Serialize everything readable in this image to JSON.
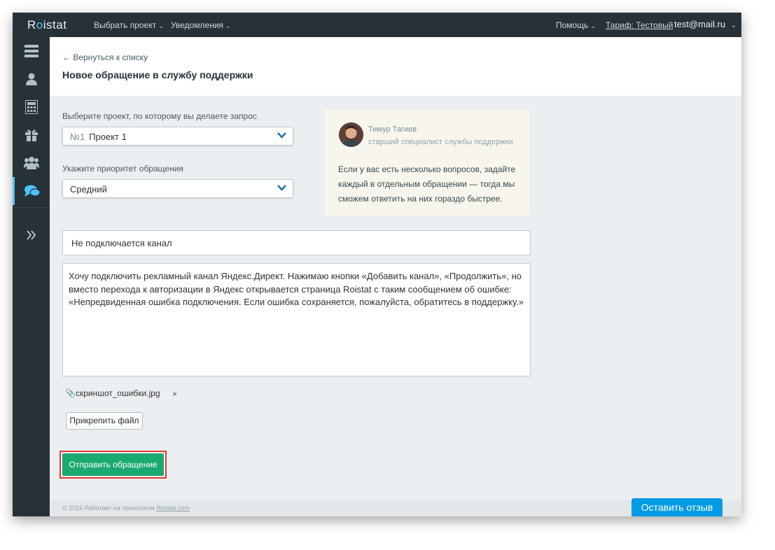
{
  "app": {
    "logo_prefix": "R",
    "logo_o": "o",
    "logo_suffix": "istat"
  },
  "topnav": {
    "choose_project": "Выбрать проект",
    "notifications": "Уведомления",
    "help": "Помощь",
    "tariff": "Тариф: Тестовый",
    "user_email": "test@mail.ru"
  },
  "sidebar": {
    "items": [
      {
        "icon": "server-stack-icon"
      },
      {
        "icon": "user-icon"
      },
      {
        "icon": "calculator-icon"
      },
      {
        "icon": "gift-icon"
      },
      {
        "icon": "users-icon"
      },
      {
        "icon": "chat-icon",
        "active": true
      },
      {
        "icon": "double-chevron-right-icon"
      }
    ]
  },
  "header": {
    "back_link": "← Вернуться к списку",
    "title": "Новое обращение в службу поддержки"
  },
  "form": {
    "project_label": "Выберите проект, по которому вы делаете запрос",
    "project_number": "№1",
    "project_value": "Проект 1",
    "priority_label": "Укажите приоритет обращения",
    "priority_value": "Средний",
    "subject_value": "Не подключается канал",
    "message_value": "Хочу подключить рекламный канал Яндекс.Директ. Нажимаю кнопки «Добавить канал», «Продолжить», но вместо перехода к авторизации в Яндекс открывается страница Roistat  с  таким сообщением об ошибке: «Непредвиденная ошибка подключения. Если ошибка сохраняется, пожалуйста, обратитесь в поддержку.»",
    "attachment_name": "скриншот_ошибки.jpg",
    "attachment_remove": "×",
    "attach_button": "Прикрепить файл",
    "submit_button": "Отправить обращение"
  },
  "tip": {
    "name": "Тимур Тагиев",
    "role": "старший специалист службы поддержки",
    "text": "Если у вас есть несколько вопросов, задайте каждый в отдельным обращении — тогда мы сможем ответить на них гораздо быстрее."
  },
  "footer": {
    "text": "© 2016 Работает на технологии ",
    "link": "Roistat.com"
  },
  "feedback_button": "Оставить отзыв",
  "colors": {
    "topbar": "#263238",
    "accent": "#4fc3f7",
    "submit": "#1aa970",
    "feedback": "#039be5",
    "highlight": "#e53935"
  }
}
